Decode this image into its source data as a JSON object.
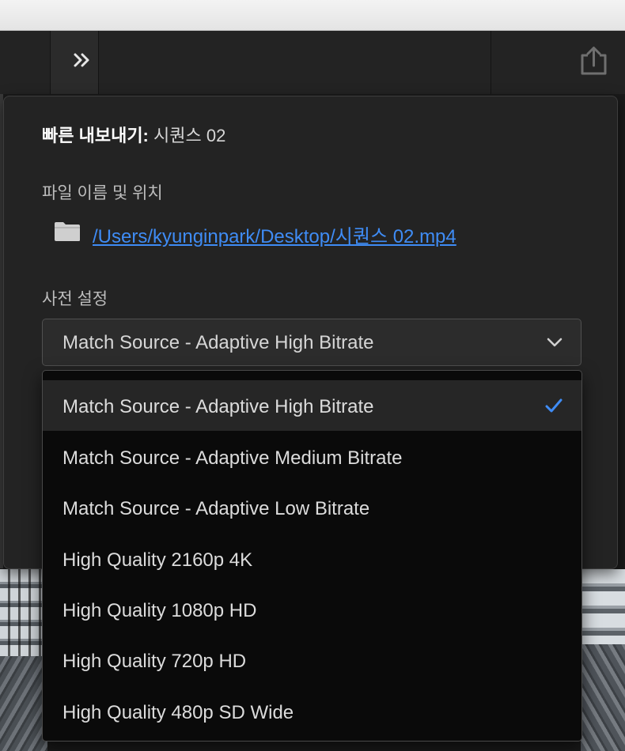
{
  "dialog": {
    "title_bold": "빠른 내보내기:",
    "title_sequence": "시퀀스 02",
    "file_section_label": "파일 이름 및 위치",
    "file_path": "/Users/kyunginpark/Desktop/시퀀스 02.mp4",
    "preset_section_label": "사전 설정",
    "preset_selected": "Match Source - Adaptive High Bitrate"
  },
  "preset_options": [
    {
      "label": "Match Source - Adaptive High Bitrate",
      "selected": true
    },
    {
      "label": "Match Source - Adaptive Medium Bitrate",
      "selected": false
    },
    {
      "label": "Match Source - Adaptive Low Bitrate",
      "selected": false
    },
    {
      "label": "High Quality 2160p 4K",
      "selected": false
    },
    {
      "label": "High Quality 1080p HD",
      "selected": false
    },
    {
      "label": "High Quality 720p HD",
      "selected": false
    },
    {
      "label": "High Quality 480p SD Wide",
      "selected": false
    }
  ],
  "icons": {
    "toolbar_left": "double-chevron-right-icon",
    "toolbar_right": "share-export-icon",
    "file": "folder-icon",
    "select": "chevron-down-icon",
    "selected_option": "checkmark-icon"
  },
  "colors": {
    "accent": "#3f8cf5",
    "panel_bg": "#232323",
    "dropdown_bg": "#0a0a0a",
    "selected_row_bg": "#262626"
  }
}
